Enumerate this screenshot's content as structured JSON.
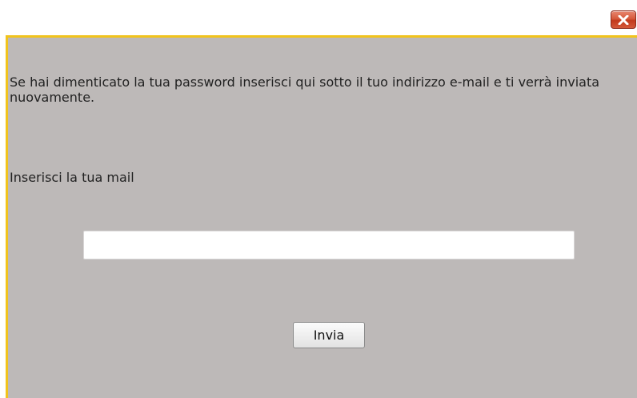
{
  "dialog": {
    "message": "Se hai dimenticato la tua password inserisci qui sotto il tuo indirizzo e-mail e ti verrà inviata nuovamente.",
    "email_label": "Inserisci la tua mail",
    "email_value": "",
    "email_placeholder": "",
    "submit_label": "Invia"
  },
  "controls": {
    "close_icon": "close-x-icon"
  },
  "colors": {
    "dialog_background": "#bdb9b8",
    "dialog_border": "#f1c31c",
    "close_button": "#d65a3c",
    "text": "#222222"
  }
}
